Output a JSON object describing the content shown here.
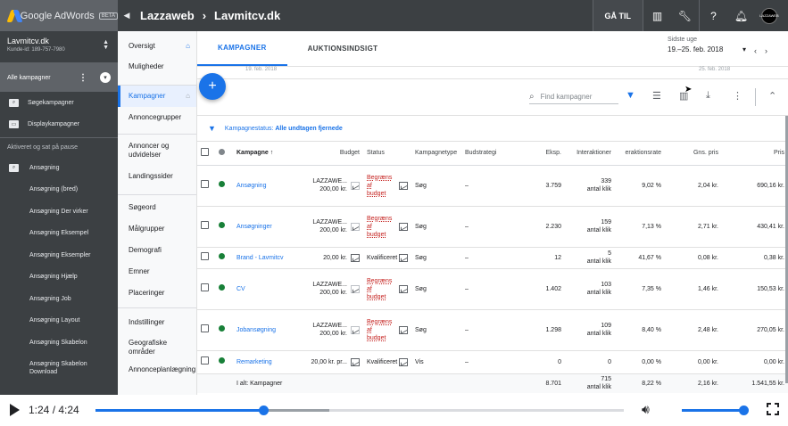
{
  "topbar": {
    "brand_name": "Google AdWords",
    "brand_badge": "BETA",
    "crumb_parent": "Lazzaweb",
    "crumb_current": "Lavmitcv.dk",
    "goto_label": "GÅ TIL",
    "avatar_text": "LAZZAWEB"
  },
  "account": {
    "name": "Lavmitcv.dk",
    "id": "Kunde-id: 189-757-7980"
  },
  "sidebar": {
    "all_campaigns": "Alle kampagner",
    "search_campaigns": "Søgekampagner",
    "display_campaigns": "Displaykampagner",
    "status_label": "Aktiveret og sat på pause",
    "campaigns": [
      "Ansøgning",
      "Ansøgning (bred)",
      "Ansøgning Der virker",
      "Ansøgning Eksempel",
      "Ansøgning Eksempler",
      "Ansøgning Hjælp",
      "Ansøgning Job",
      "Ansøgning Layout",
      "Ansøgning Skabelon",
      "Ansøgning Skabelon Download"
    ]
  },
  "nav": {
    "items": [
      "Oversigt",
      "Muligheder",
      "Kampagner",
      "Annoncegrupper",
      "Annoncer og udvidelser",
      "Landingssider",
      "Søgeord",
      "Målgrupper",
      "Demografi",
      "Emner",
      "Placeringer",
      "Indstillinger",
      "Geografiske områder",
      "Annonceplanlægning"
    ]
  },
  "tabs": {
    "campaigns": "KAMPAGNER",
    "auction": "AUKTIONSINDSIGT"
  },
  "daterange": {
    "label": "Sidste uge",
    "value": "19.–25. feb. 2018",
    "axis_start": "19. feb. 2018",
    "axis_end": "25. feb. 2018"
  },
  "toolbar": {
    "search_placeholder": "Find kampagner"
  },
  "filter": {
    "label": "Kampagnestatus:",
    "value": "Alle undtagen fjernede"
  },
  "table": {
    "headers": {
      "campaign": "Kampagne",
      "budget": "Budget",
      "status": "Status",
      "type": "Kampagnetype",
      "strategy": "Budstrategi",
      "impr": "Eksp.",
      "interactions": "Interaktioner",
      "rate": "eraktionsrate",
      "avg": "Gns. pris",
      "cost": "Pris"
    },
    "rows": [
      {
        "name": "Ansøgning",
        "budget": "LAZZAWE... 200,00 kr.",
        "status": "Begræns af budget",
        "type": "Søg",
        "strategy": "–",
        "impr": "3.759",
        "inter": "339 antal klik",
        "rate": "9,02 %",
        "avg": "2,04 kr.",
        "cost": "690,16 kr."
      },
      {
        "name": "Ansøgninger",
        "budget": "LAZZAWE... 200,00 kr.",
        "status": "Begræns af budget",
        "type": "Søg",
        "strategy": "–",
        "impr": "2.230",
        "inter": "159 antal klik",
        "rate": "7,13 %",
        "avg": "2,71 kr.",
        "cost": "430,41 kr."
      },
      {
        "name": "Brand - Lavmitcv",
        "budget": "20,00 kr.",
        "status": "Kvalificeret",
        "type": "Søg",
        "strategy": "–",
        "impr": "12",
        "inter": "5 antal klik",
        "rate": "41,67 %",
        "avg": "0,08 kr.",
        "cost": "0,38 kr."
      },
      {
        "name": "CV",
        "budget": "LAZZAWE... 200,00 kr.",
        "status": "Begræns af budget",
        "type": "Søg",
        "strategy": "–",
        "impr": "1.402",
        "inter": "103 antal klik",
        "rate": "7,35 %",
        "avg": "1,46 kr.",
        "cost": "150,53 kr."
      },
      {
        "name": "Jobansøgning",
        "budget": "LAZZAWE... 200,00 kr.",
        "status": "Begræns af budget",
        "type": "Søg",
        "strategy": "–",
        "impr": "1.298",
        "inter": "109 antal klik",
        "rate": "8,40 %",
        "avg": "2,48 kr.",
        "cost": "270,05 kr."
      },
      {
        "name": "Remarketing",
        "budget": "20,00 kr. pr...",
        "status": "Kvalificeret",
        "type": "Vis",
        "strategy": "–",
        "impr": "0",
        "inter": "0",
        "rate": "0,00 %",
        "avg": "0,00 kr.",
        "cost": "0,00 kr."
      }
    ],
    "total": {
      "label": "I alt: Kampagner",
      "impr": "8.701",
      "inter": "715 antal klik",
      "rate": "8,22 %",
      "avg": "2,16 kr.",
      "cost": "1.541,55 kr."
    }
  },
  "video": {
    "time": "1:24 / 4:24",
    "progress": 0.318,
    "volume": 0.95
  }
}
